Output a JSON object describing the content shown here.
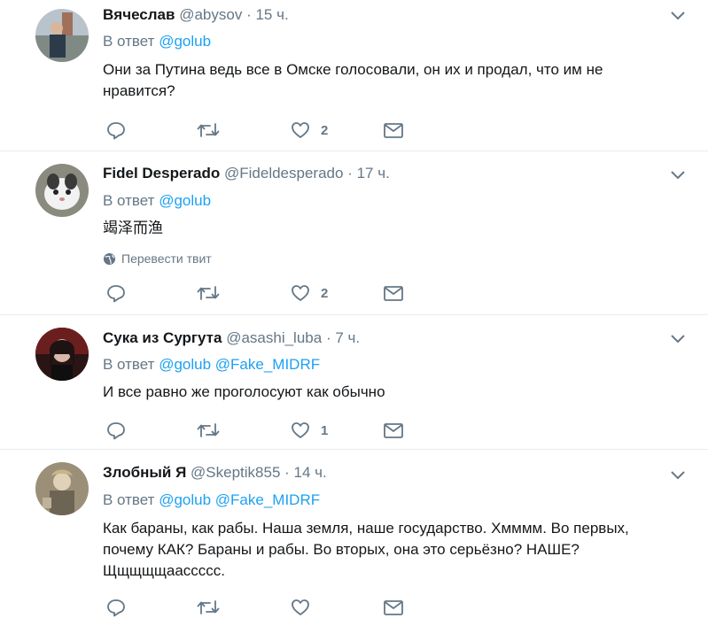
{
  "tweets": [
    {
      "name": "Вячеслав",
      "handle": "@abysov",
      "dot": "·",
      "time": "15 ч.",
      "reply_prefix": "В ответ",
      "mentions": [
        "@golub"
      ],
      "text": "Они за Путина ведь все в Омске голосовали, он их и продал, что им не нравится?",
      "likes": "2"
    },
    {
      "name": "Fidel Desperado",
      "handle": "@Fideldesperado",
      "dot": "·",
      "time": "17 ч.",
      "reply_prefix": "В ответ",
      "mentions": [
        "@golub"
      ],
      "text": "竭泽而渔",
      "translate": "Перевести твит",
      "likes": "2"
    },
    {
      "name": "Сука из Сургута",
      "handle": "@asashi_luba",
      "dot": "·",
      "time": "7 ч.",
      "reply_prefix": "В ответ",
      "mentions": [
        "@golub",
        "@Fake_MIDRF"
      ],
      "text": "И все равно же проголосуют как обычно",
      "likes": "1"
    },
    {
      "name": "Злобный Я",
      "handle": "@Skeptik855",
      "dot": "·",
      "time": "14 ч.",
      "reply_prefix": "В ответ",
      "mentions": [
        "@golub",
        "@Fake_MIDRF"
      ],
      "text": "Как бараны, как рабы. Наша земля, наше государство. Хмммм. Во первых, почему КАК? Бараны и рабы. Во вторых, она это серьёзно? НАШЕ? Щщщщщаассссс.",
      "likes": ""
    }
  ],
  "icons": {
    "reply": "reply-icon",
    "retweet": "retweet-icon",
    "like": "heart-icon",
    "dm": "envelope-icon",
    "caret": "chevron-down-icon",
    "globe": "globe-icon"
  },
  "colors": {
    "text": "#14171a",
    "secondary": "#657786",
    "link": "#1da1f2",
    "divider": "#e6ecf0"
  }
}
